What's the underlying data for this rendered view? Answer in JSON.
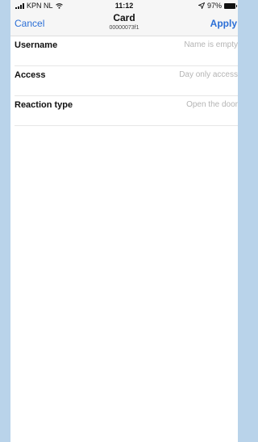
{
  "status": {
    "carrier": "KPN NL",
    "time": "11:12",
    "battery": "97%",
    "icons": [
      "signal-icon",
      "wifi-icon",
      "location-icon",
      "battery-icon"
    ]
  },
  "nav": {
    "cancel": "Cancel",
    "title": "Card",
    "subtitle": "00000073f1",
    "apply": "Apply"
  },
  "rows": [
    {
      "label": "Username",
      "value": "Name is empty"
    },
    {
      "label": "Access",
      "value": "Day only access"
    },
    {
      "label": "Reaction type",
      "value": "Open the door"
    }
  ],
  "colors": {
    "accent": "#2b6fd6",
    "backdrop": "#b9d3ea",
    "placeholder": "#b4b4b4"
  }
}
